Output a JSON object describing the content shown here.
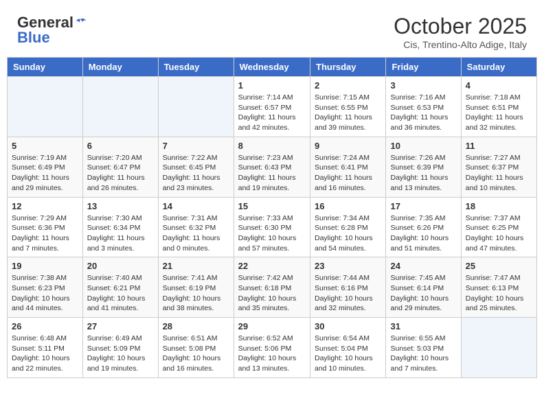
{
  "header": {
    "logo_general": "General",
    "logo_blue": "Blue",
    "month": "October 2025",
    "location": "Cis, Trentino-Alto Adige, Italy"
  },
  "days_of_week": [
    "Sunday",
    "Monday",
    "Tuesday",
    "Wednesday",
    "Thursday",
    "Friday",
    "Saturday"
  ],
  "weeks": [
    [
      {
        "day": "",
        "info": ""
      },
      {
        "day": "",
        "info": ""
      },
      {
        "day": "",
        "info": ""
      },
      {
        "day": "1",
        "info": "Sunrise: 7:14 AM\nSunset: 6:57 PM\nDaylight: 11 hours and 42 minutes."
      },
      {
        "day": "2",
        "info": "Sunrise: 7:15 AM\nSunset: 6:55 PM\nDaylight: 11 hours and 39 minutes."
      },
      {
        "day": "3",
        "info": "Sunrise: 7:16 AM\nSunset: 6:53 PM\nDaylight: 11 hours and 36 minutes."
      },
      {
        "day": "4",
        "info": "Sunrise: 7:18 AM\nSunset: 6:51 PM\nDaylight: 11 hours and 32 minutes."
      }
    ],
    [
      {
        "day": "5",
        "info": "Sunrise: 7:19 AM\nSunset: 6:49 PM\nDaylight: 11 hours and 29 minutes."
      },
      {
        "day": "6",
        "info": "Sunrise: 7:20 AM\nSunset: 6:47 PM\nDaylight: 11 hours and 26 minutes."
      },
      {
        "day": "7",
        "info": "Sunrise: 7:22 AM\nSunset: 6:45 PM\nDaylight: 11 hours and 23 minutes."
      },
      {
        "day": "8",
        "info": "Sunrise: 7:23 AM\nSunset: 6:43 PM\nDaylight: 11 hours and 19 minutes."
      },
      {
        "day": "9",
        "info": "Sunrise: 7:24 AM\nSunset: 6:41 PM\nDaylight: 11 hours and 16 minutes."
      },
      {
        "day": "10",
        "info": "Sunrise: 7:26 AM\nSunset: 6:39 PM\nDaylight: 11 hours and 13 minutes."
      },
      {
        "day": "11",
        "info": "Sunrise: 7:27 AM\nSunset: 6:37 PM\nDaylight: 11 hours and 10 minutes."
      }
    ],
    [
      {
        "day": "12",
        "info": "Sunrise: 7:29 AM\nSunset: 6:36 PM\nDaylight: 11 hours and 7 minutes."
      },
      {
        "day": "13",
        "info": "Sunrise: 7:30 AM\nSunset: 6:34 PM\nDaylight: 11 hours and 3 minutes."
      },
      {
        "day": "14",
        "info": "Sunrise: 7:31 AM\nSunset: 6:32 PM\nDaylight: 11 hours and 0 minutes."
      },
      {
        "day": "15",
        "info": "Sunrise: 7:33 AM\nSunset: 6:30 PM\nDaylight: 10 hours and 57 minutes."
      },
      {
        "day": "16",
        "info": "Sunrise: 7:34 AM\nSunset: 6:28 PM\nDaylight: 10 hours and 54 minutes."
      },
      {
        "day": "17",
        "info": "Sunrise: 7:35 AM\nSunset: 6:26 PM\nDaylight: 10 hours and 51 minutes."
      },
      {
        "day": "18",
        "info": "Sunrise: 7:37 AM\nSunset: 6:25 PM\nDaylight: 10 hours and 47 minutes."
      }
    ],
    [
      {
        "day": "19",
        "info": "Sunrise: 7:38 AM\nSunset: 6:23 PM\nDaylight: 10 hours and 44 minutes."
      },
      {
        "day": "20",
        "info": "Sunrise: 7:40 AM\nSunset: 6:21 PM\nDaylight: 10 hours and 41 minutes."
      },
      {
        "day": "21",
        "info": "Sunrise: 7:41 AM\nSunset: 6:19 PM\nDaylight: 10 hours and 38 minutes."
      },
      {
        "day": "22",
        "info": "Sunrise: 7:42 AM\nSunset: 6:18 PM\nDaylight: 10 hours and 35 minutes."
      },
      {
        "day": "23",
        "info": "Sunrise: 7:44 AM\nSunset: 6:16 PM\nDaylight: 10 hours and 32 minutes."
      },
      {
        "day": "24",
        "info": "Sunrise: 7:45 AM\nSunset: 6:14 PM\nDaylight: 10 hours and 29 minutes."
      },
      {
        "day": "25",
        "info": "Sunrise: 7:47 AM\nSunset: 6:13 PM\nDaylight: 10 hours and 25 minutes."
      }
    ],
    [
      {
        "day": "26",
        "info": "Sunrise: 6:48 AM\nSunset: 5:11 PM\nDaylight: 10 hours and 22 minutes."
      },
      {
        "day": "27",
        "info": "Sunrise: 6:49 AM\nSunset: 5:09 PM\nDaylight: 10 hours and 19 minutes."
      },
      {
        "day": "28",
        "info": "Sunrise: 6:51 AM\nSunset: 5:08 PM\nDaylight: 10 hours and 16 minutes."
      },
      {
        "day": "29",
        "info": "Sunrise: 6:52 AM\nSunset: 5:06 PM\nDaylight: 10 hours and 13 minutes."
      },
      {
        "day": "30",
        "info": "Sunrise: 6:54 AM\nSunset: 5:04 PM\nDaylight: 10 hours and 10 minutes."
      },
      {
        "day": "31",
        "info": "Sunrise: 6:55 AM\nSunset: 5:03 PM\nDaylight: 10 hours and 7 minutes."
      },
      {
        "day": "",
        "info": ""
      }
    ]
  ]
}
